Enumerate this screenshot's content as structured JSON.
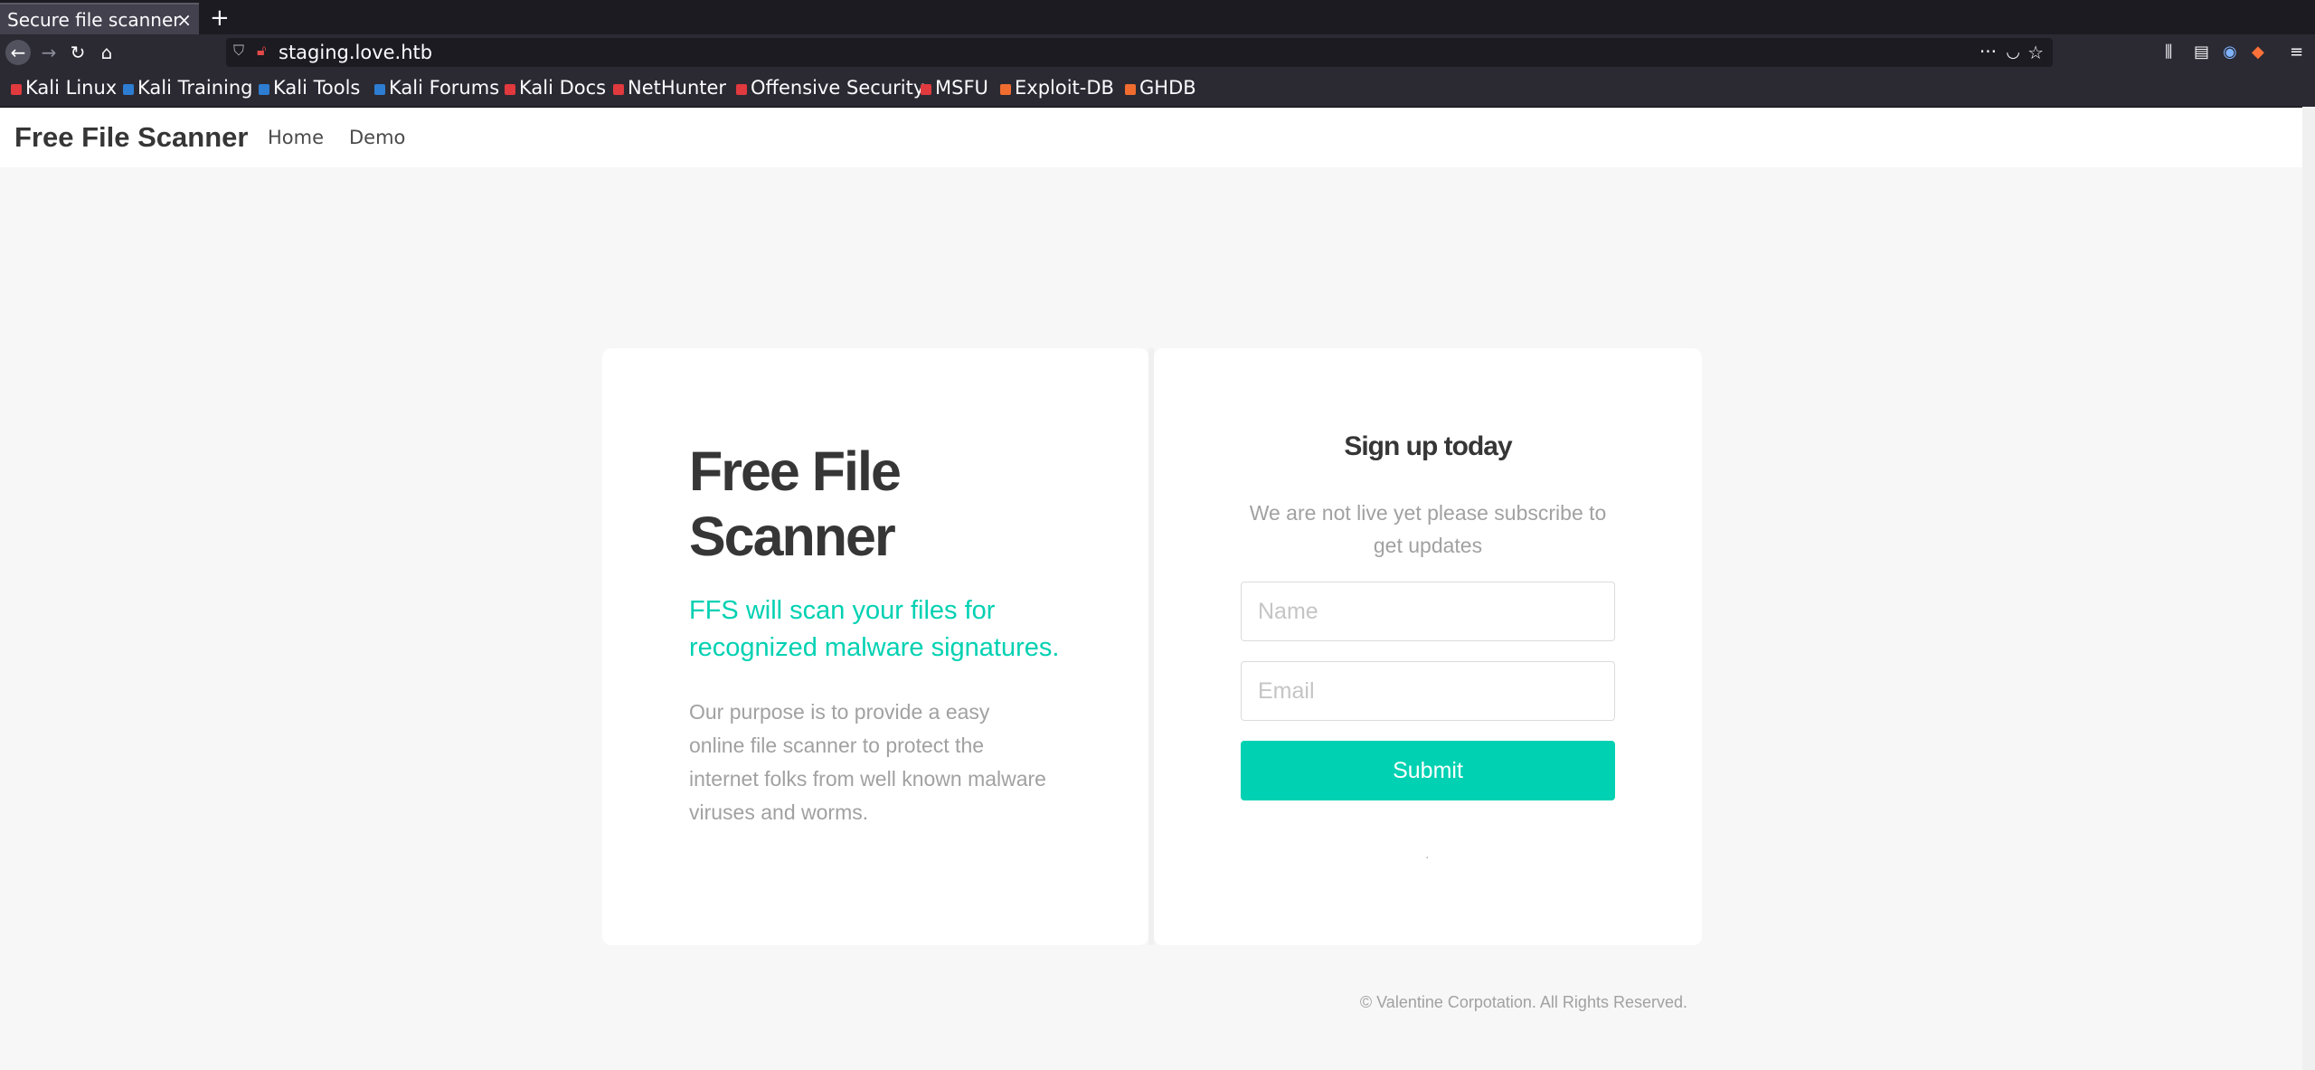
{
  "browser": {
    "tab_title": "Secure file scanner",
    "tab_close": "×",
    "new_tab": "+",
    "url": "staging.love.htb",
    "bookmarks": [
      {
        "label": "Kali Linux",
        "color": "#e0393e"
      },
      {
        "label": "Kali Training",
        "color": "#2d7dd2"
      },
      {
        "label": "Kali Tools",
        "color": "#2d7dd2"
      },
      {
        "label": "Kali Forums",
        "color": "#2d7dd2"
      },
      {
        "label": "Kali Docs",
        "color": "#e0393e"
      },
      {
        "label": "NetHunter",
        "color": "#e0393e"
      },
      {
        "label": "Offensive Security",
        "color": "#e0393e"
      },
      {
        "label": "MSFU",
        "color": "#e0393e"
      },
      {
        "label": "Exploit-DB",
        "color": "#f06c2f"
      },
      {
        "label": "GHDB",
        "color": "#f06c2f"
      }
    ]
  },
  "site": {
    "brand": "Free File Scanner",
    "nav": [
      "Home",
      "Demo"
    ]
  },
  "hero": {
    "title": "Free File Scanner",
    "subtitle": "FFS will scan your files for recognized malware signatures.",
    "body": "Our purpose is to provide a easy online file scanner to protect the internet folks from well known malware viruses and worms."
  },
  "signup": {
    "title": "Sign up today",
    "text": "We are not live yet please subscribe to get updates",
    "name_placeholder": "Name",
    "email_placeholder": "Email",
    "submit_label": "Submit",
    "dot": "."
  },
  "footer": {
    "text": "© Valentine Corpotation. All Rights Reserved."
  },
  "colors": {
    "accent": "#00d1b2",
    "text_dark": "#363636",
    "text_muted": "#a1a1a1"
  }
}
